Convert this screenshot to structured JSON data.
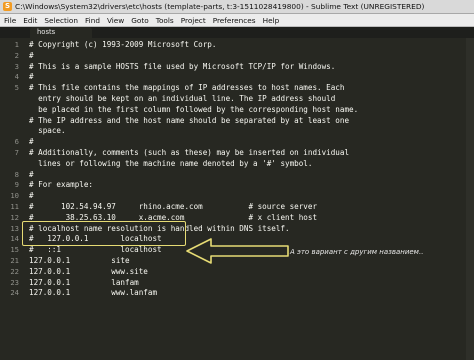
{
  "window": {
    "title": "C:\\Windows\\System32\\drivers\\etc\\hosts (template-parts, t:3-1511028419800) - Sublime Text (UNREGISTERED)",
    "app_icon": "sublime-text-icon"
  },
  "menu": [
    "File",
    "Edit",
    "Selection",
    "Find",
    "View",
    "Goto",
    "Tools",
    "Project",
    "Preferences",
    "Help"
  ],
  "tabs": [
    {
      "label": "hosts",
      "active": true
    }
  ],
  "editor": {
    "lines": [
      {
        "no": "1",
        "text": "# Copyright (c) 1993-2009 Microsoft Corp."
      },
      {
        "no": "2",
        "text": "#"
      },
      {
        "no": "3",
        "text": "# This is a sample HOSTS file used by Microsoft TCP/IP for Windows."
      },
      {
        "no": "4",
        "text": "#"
      },
      {
        "no": "5",
        "text": "# This file contains the mappings of IP addresses to host names. Each"
      },
      {
        "no": "",
        "text": "  entry should be kept on an individual line. The IP address should"
      },
      {
        "no": "",
        "text": "  be placed in the first column followed by the corresponding host name."
      },
      {
        "no": "",
        "text": "# The IP address and the host name should be separated by at least one"
      },
      {
        "no": "",
        "text": "  space."
      },
      {
        "no": "6",
        "text": "#"
      },
      {
        "no": "7",
        "text": "# Additionally, comments (such as these) may be inserted on individual"
      },
      {
        "no": "",
        "text": "  lines or following the machine name denoted by a '#' symbol."
      },
      {
        "no": "8",
        "text": "#"
      },
      {
        "no": "9",
        "text": "# For example:"
      },
      {
        "no": "10",
        "text": "#"
      },
      {
        "no": "11",
        "text": "#      102.54.94.97     rhino.acme.com          # source server"
      },
      {
        "no": "12",
        "text": "#       38.25.63.10     x.acme.com              # x client host"
      },
      {
        "no": "13",
        "text": "# localhost name resolution is handled within DNS itself."
      },
      {
        "no": "14",
        "text": "#   127.0.0.1       localhost"
      },
      {
        "no": "15",
        "text": "#   ::1             localhost"
      },
      {
        "no": "21",
        "text": "127.0.0.1         site"
      },
      {
        "no": "22",
        "text": "127.0.0.1         www.site"
      },
      {
        "no": "23",
        "text": "127.0.0.1         lanfam"
      },
      {
        "no": "24",
        "text": "127.0.0.1         www.lanfam"
      }
    ]
  },
  "annotation": {
    "text": "А это вариант с другим названием..",
    "color": "#e6db74"
  },
  "colors": {
    "editor_bg": "#272822",
    "text": "#f8f8f2",
    "line_numbers": "#8f908a",
    "highlight": "#e6db74"
  }
}
